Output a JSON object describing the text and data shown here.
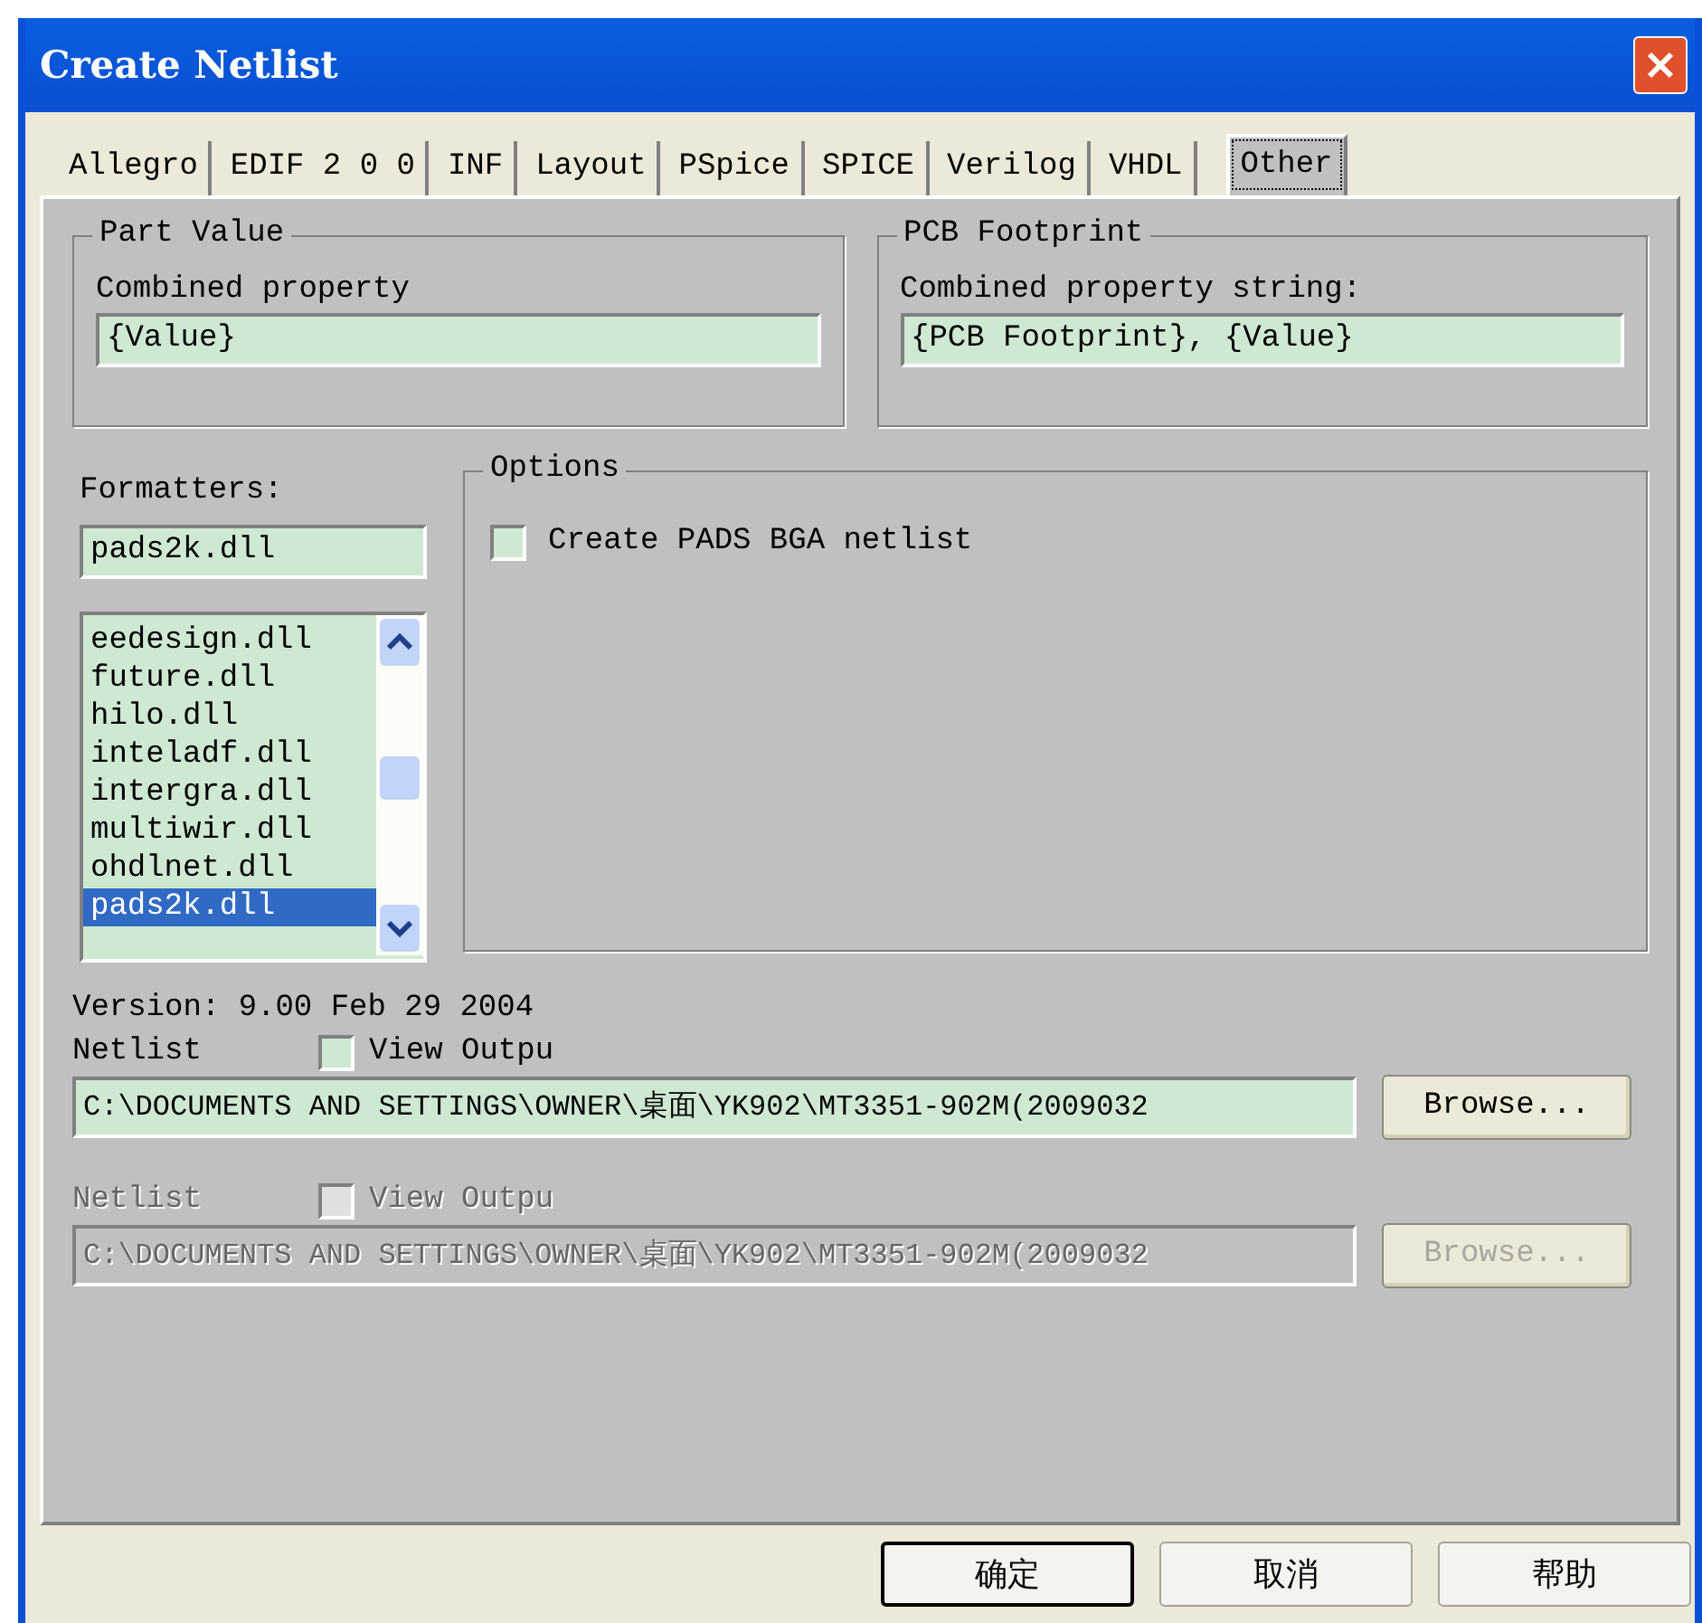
{
  "window": {
    "title": "Create Netlist"
  },
  "tabs": [
    {
      "label": "Allegro",
      "selected": false
    },
    {
      "label": "EDIF 2 0 0",
      "selected": false
    },
    {
      "label": "INF",
      "selected": false
    },
    {
      "label": "Layout",
      "selected": false
    },
    {
      "label": "PSpice",
      "selected": false
    },
    {
      "label": "SPICE",
      "selected": false
    },
    {
      "label": "Verilog",
      "selected": false
    },
    {
      "label": "VHDL",
      "selected": false
    },
    {
      "label": "Other",
      "selected": true
    }
  ],
  "part_value": {
    "title": "Part Value",
    "label": "Combined property",
    "value": "{Value}"
  },
  "pcb_footprint": {
    "title": "PCB Footprint",
    "label": "Combined property string:",
    "value": "{PCB Footprint}, {Value}"
  },
  "formatters": {
    "label": "Formatters:",
    "value": "pads2k.dll",
    "items": [
      {
        "label": "eedesign.dll",
        "selected": false
      },
      {
        "label": "future.dll",
        "selected": false
      },
      {
        "label": "hilo.dll",
        "selected": false
      },
      {
        "label": "inteladf.dll",
        "selected": false
      },
      {
        "label": "intergra.dll",
        "selected": false
      },
      {
        "label": "multiwir.dll",
        "selected": false
      },
      {
        "label": "ohdlnet.dll",
        "selected": false
      },
      {
        "label": "pads2k.dll",
        "selected": true
      }
    ]
  },
  "options": {
    "title": "Options",
    "checkboxes": [
      {
        "label": "Create PADS BGA netlist",
        "checked": false
      }
    ]
  },
  "version": "Version: 9.00  Feb 29 2004",
  "netlist_rows": [
    {
      "label": "Netlist",
      "view_output": "View Outpu",
      "checked": false,
      "disabled": false,
      "path": "C:\\DOCUMENTS AND SETTINGS\\OWNER\\桌面\\YK902\\MT3351-902M(2009032",
      "browse": "Browse..."
    },
    {
      "label": "Netlist",
      "view_output": "View Outpu",
      "checked": false,
      "disabled": true,
      "path": "C:\\DOCUMENTS AND SETTINGS\\OWNER\\桌面\\YK902\\MT3351-902M(2009032",
      "browse": "Browse..."
    }
  ],
  "buttons": [
    {
      "label": "确定",
      "default": true
    },
    {
      "label": "取消",
      "default": false
    },
    {
      "label": "帮助",
      "default": false
    }
  ]
}
